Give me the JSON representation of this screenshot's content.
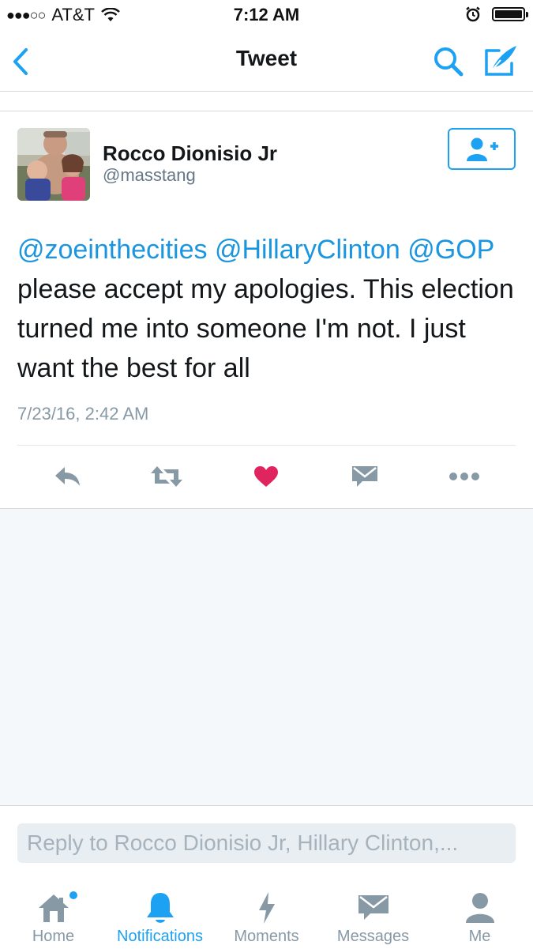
{
  "status_bar": {
    "carrier": "AT&T",
    "time": "7:12 AM"
  },
  "nav": {
    "title": "Tweet"
  },
  "tweet": {
    "author_name": "Rocco Dionisio Jr",
    "author_handle": "@masstang",
    "mentions": [
      "@zoeinthecities",
      "@HillaryClinton",
      "@GOP"
    ],
    "body": "please accept my apologies. This election turned me into someone I'm not. I just want the best for all",
    "timestamp": "7/23/16, 2:42 AM",
    "liked": true
  },
  "reply": {
    "placeholder": "Reply to Rocco Dionisio Jr, Hillary Clinton,..."
  },
  "tabs": [
    {
      "label": "Home",
      "icon": "home-icon",
      "active": false
    },
    {
      "label": "Notifications",
      "icon": "bell-icon",
      "active": true
    },
    {
      "label": "Moments",
      "icon": "lightning-icon",
      "active": false
    },
    {
      "label": "Messages",
      "icon": "envelope-icon",
      "active": false
    },
    {
      "label": "Me",
      "icon": "person-icon",
      "active": false
    }
  ],
  "colors": {
    "accent": "#1da1f2",
    "mention": "#1b95e0",
    "like": "#e0245e",
    "muted": "#8899a6"
  }
}
